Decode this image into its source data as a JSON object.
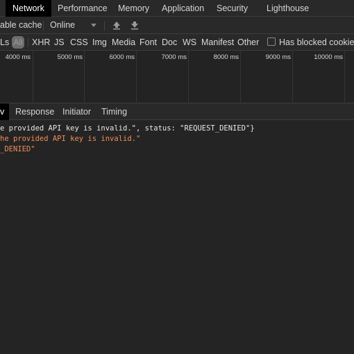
{
  "tabs": [
    {
      "label": "Network",
      "active": true
    },
    {
      "label": "Performance"
    },
    {
      "label": "Memory"
    },
    {
      "label": "Application"
    },
    {
      "label": "Security"
    },
    {
      "label": "Lighthouse"
    }
  ],
  "toolbar": {
    "disable_cache_label": "able cache",
    "throttle_value": "Online",
    "import_icon": "upload-arrow-icon",
    "export_icon": "download-arrow-icon"
  },
  "filters": {
    "partial_label": "Ls",
    "all_label": "All",
    "types": [
      "XHR",
      "JS",
      "CSS",
      "Img",
      "Media",
      "Font",
      "Doc",
      "WS",
      "Manifest",
      "Other"
    ],
    "blocked_cookies_label": "Has blocked cookies",
    "blocked_cookies_checked": false
  },
  "timeline": {
    "ticks": [
      "4000 ms",
      "5000 ms",
      "6000 ms",
      "7000 ms",
      "8000 ms",
      "9000 ms",
      "10000 ms"
    ]
  },
  "detail_tabs": [
    {
      "label": "v",
      "active": true
    },
    {
      "label": "Response"
    },
    {
      "label": "Initiator"
    },
    {
      "label": "Timing"
    }
  ],
  "preview": {
    "lines": [
      {
        "text": "e provided API key is invalid.\", status: \"REQUEST_DENIED\"}",
        "color": "white"
      },
      {
        "text": "he provided API key is invalid.\"",
        "color": "orange"
      },
      {
        "text": "_DENIED\"",
        "color": "orange"
      }
    ]
  },
  "colors": {
    "string_value": "#f28b54",
    "active_tab_bg": "#000000",
    "panel_bg": "#242424"
  }
}
